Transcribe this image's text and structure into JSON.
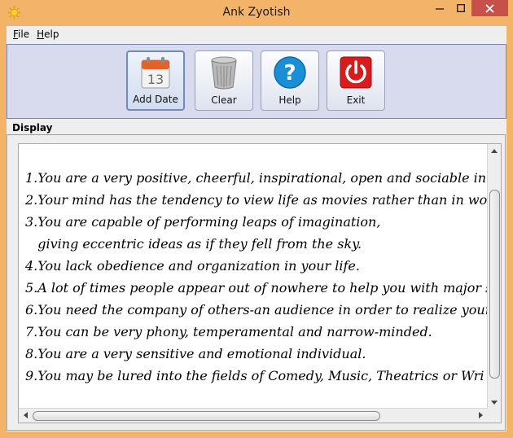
{
  "window": {
    "title": "Ank Zyotish",
    "icon": "sun-icon",
    "controls": [
      "minimize-icon",
      "maximize-icon",
      "close-icon"
    ]
  },
  "menu": {
    "items": [
      {
        "label": "File",
        "mnemonic": "F"
      },
      {
        "label": "Help",
        "mnemonic": "H"
      }
    ]
  },
  "toolbar": {
    "buttons": [
      {
        "label": "Add Date",
        "icon": "calendar-icon",
        "calendar_day": "13",
        "selected": true
      },
      {
        "label": "Clear",
        "icon": "trash-icon"
      },
      {
        "label": "Help",
        "icon": "help-icon",
        "glyph": "?"
      },
      {
        "label": "Exit",
        "icon": "power-icon"
      }
    ]
  },
  "display": {
    "title": "Display",
    "lines": [
      "1.You are a very positive, cheerful, inspirational, open and sociable in",
      "2.Your mind has the tendency to view life as movies rather than in wor",
      "3.You are capable of performing leaps of imagination,",
      "   giving eccentric ideas as if they fell from the sky.",
      "4.You lack obedience and organization in your life.",
      "5.A lot of times people appear out of nowhere to help you with major s",
      "6.You need the company of others-an audience in order to realize your",
      "7.You can be very phony, temperamental and narrow-minded.",
      "8.You are a very sensitive and emotional individual.",
      "9.You may be lured into the fields of Comedy, Music, Theatrics or Wri"
    ]
  },
  "colors": {
    "titlebar": "#f3b46a",
    "close_button": "#c7504a",
    "toolbar_bg": "#d8daed",
    "exit_red": "#d81b1b",
    "help_blue": "#1b8fd6"
  }
}
